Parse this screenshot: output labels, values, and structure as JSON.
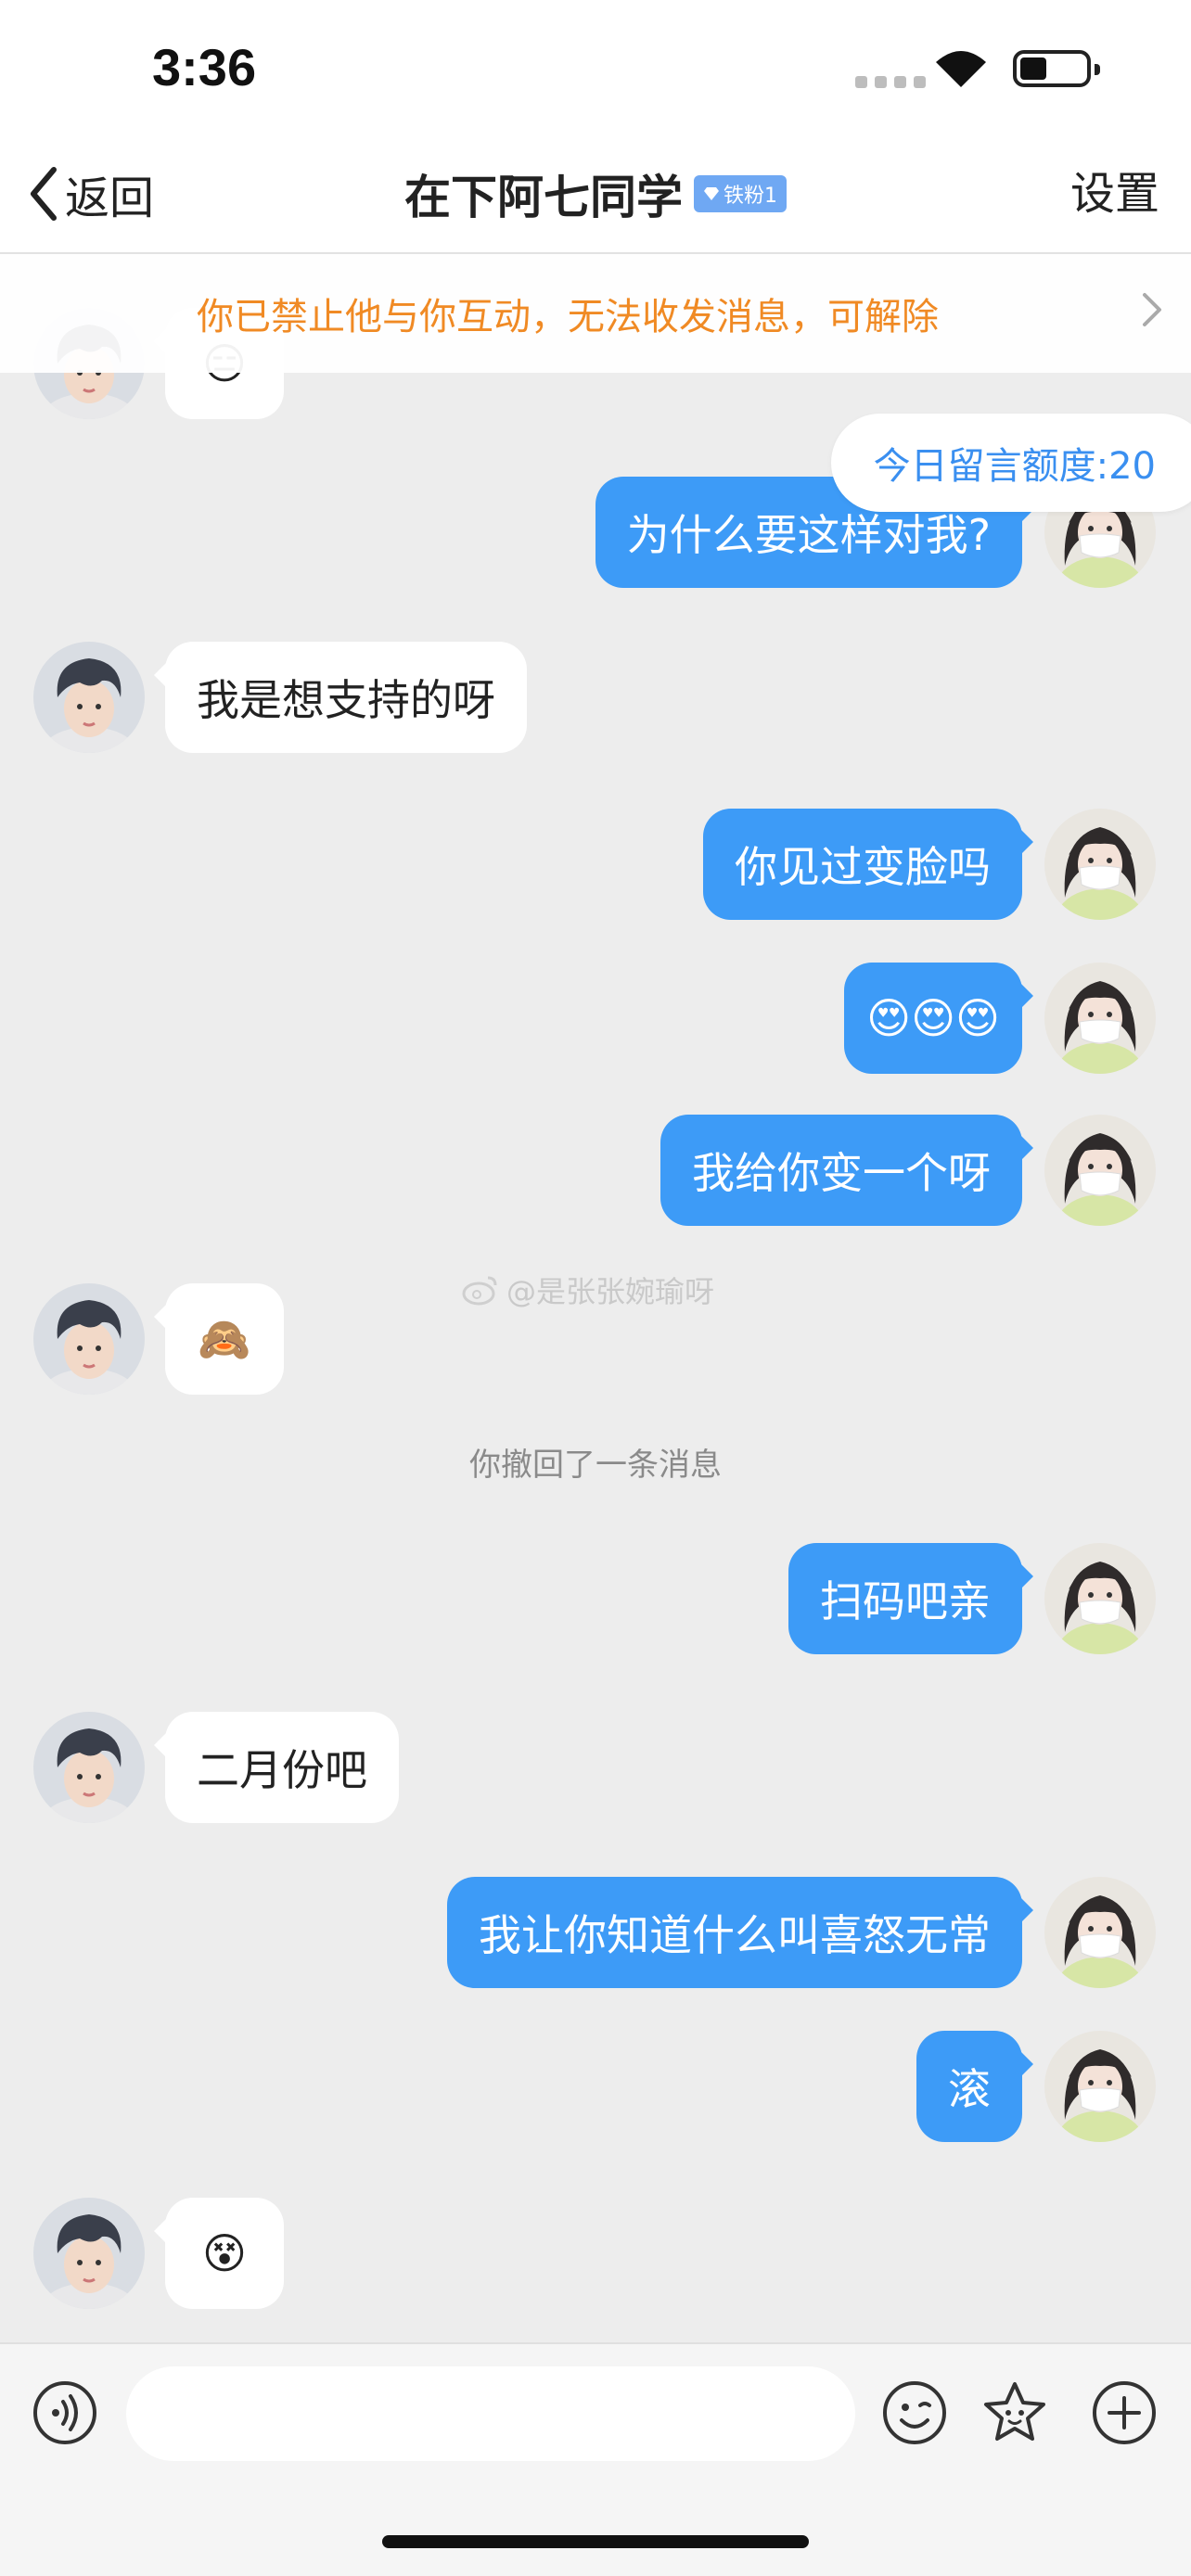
{
  "status_bar": {
    "time": "3:36"
  },
  "nav": {
    "back_label": "返回",
    "title": "在下阿七同学",
    "fan_badge": "铁粉1",
    "settings_label": "设置"
  },
  "banner": {
    "text": "你已禁止他与你互动，无法收发消息，可解除"
  },
  "quota": {
    "text": "今日留言额度:20"
  },
  "watermark": {
    "text": "@是张张婉瑜呀"
  },
  "messages": [
    {
      "side": "left",
      "type": "emoji",
      "emoji": "😑",
      "partially_hidden": true
    },
    {
      "side": "right",
      "type": "text",
      "text": "为什么要这样对我?"
    },
    {
      "side": "left",
      "type": "text",
      "text": "我是想支持的呀"
    },
    {
      "side": "right",
      "type": "text",
      "text": "你见过变脸吗"
    },
    {
      "side": "right",
      "type": "emoji",
      "emoji": "😍😍😍"
    },
    {
      "side": "right",
      "type": "text",
      "text": "我给你变一个呀"
    },
    {
      "side": "left",
      "type": "emoji",
      "emoji": "🙈"
    },
    {
      "side": "system",
      "type": "recall",
      "text": "你撤回了一条消息"
    },
    {
      "side": "right",
      "type": "text",
      "text": "扫码吧亲"
    },
    {
      "side": "left",
      "type": "text",
      "text": "二月份吧"
    },
    {
      "side": "right",
      "type": "text",
      "text": "我让你知道什么叫喜怒无常"
    },
    {
      "side": "right",
      "type": "text",
      "text": "滚"
    },
    {
      "side": "left",
      "type": "emoji",
      "emoji": "😵"
    }
  ],
  "input": {
    "placeholder": "",
    "value": ""
  },
  "icons": {
    "back": "chevron-left-icon",
    "voice": "voice-icon",
    "emoji": "smiley-icon",
    "sticker": "star-face-icon",
    "more": "plus-icon"
  },
  "colors": {
    "accent": "#3d9bf7",
    "banner_text": "#f08a24",
    "background": "#ededed"
  }
}
